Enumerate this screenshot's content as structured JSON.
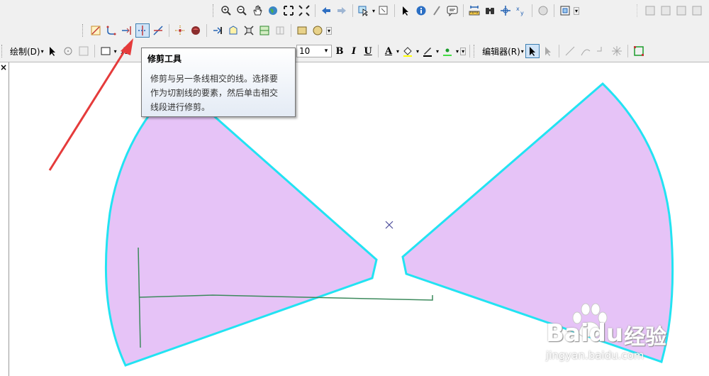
{
  "toolbar": {
    "draw_menu": "绘制(D)",
    "font_size": "10",
    "bold": "B",
    "italic": "I",
    "underline": "U",
    "font_color_letter": "A",
    "text_letter": "A",
    "editor_menu": "编辑器(R)"
  },
  "tooltip": {
    "title": "修剪工具",
    "line1": "修剪与另一条线相交的线。选择要",
    "line2": "作为切割线的要素，然后单击相交",
    "line3": "线段进行修剪。"
  },
  "panel": {
    "close_glyph": "×"
  },
  "watermark": {
    "brand": "Baidu",
    "brand_cn": "经验",
    "url": "jingyan.baidu.com"
  },
  "colors": {
    "polygon_fill": "#e6c3f7",
    "polygon_outline": "#22e3f2",
    "trim_line": "#3c8a5c",
    "arrow": "#e53b3b",
    "accent": "#3c7fb1"
  },
  "icons": [
    "zoom-in-icon",
    "zoom-out-icon",
    "pan-icon",
    "globe-icon",
    "full-extent-icon",
    "fixed-zoom-icon",
    "back-icon",
    "forward-icon",
    "select-features-icon",
    "clear-selection-icon",
    "select-elements-icon",
    "identify-icon",
    "hyperlink-icon",
    "html-popup-icon",
    "measure-icon",
    "find-icon",
    "goto-xy-icon",
    "time-slider-icon",
    "create-viewer-icon",
    "trim-tool-icon",
    "extend-tool-icon",
    "split-tool-icon"
  ]
}
